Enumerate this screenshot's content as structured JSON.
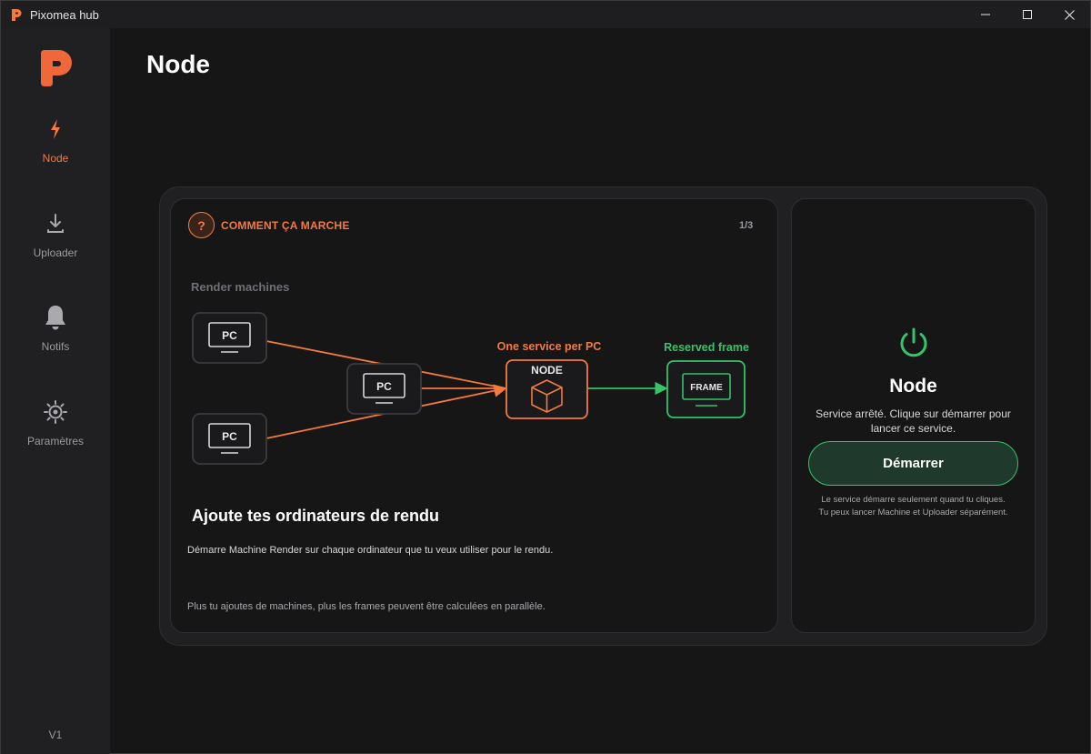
{
  "window": {
    "title": "Pixomea hub",
    "minimize": "—",
    "maximize": "☐",
    "close": "✕"
  },
  "sidebar": {
    "items": [
      {
        "label": "Node",
        "icon": "lightning-icon",
        "active": true
      },
      {
        "label": "Uploader",
        "icon": "download-icon",
        "active": false
      },
      {
        "label": "Notifs",
        "icon": "bell-icon",
        "active": false
      },
      {
        "label": "Paramètres",
        "icon": "gear-icon",
        "active": false
      }
    ],
    "version": "V1"
  },
  "page": {
    "title": "Node"
  },
  "howto": {
    "badge": "?",
    "title": "COMMENT ÇA MARCHE",
    "counter": "1/3",
    "diagram": {
      "group_label": "Render machines",
      "pc_label": "PC",
      "service_label": "One service per PC",
      "node_label": "NODE",
      "frame_title": "Reserved frame",
      "frame_label": "FRAME"
    },
    "heading": "Ajoute tes ordinateurs de rendu",
    "description": "Démarre Machine Render sur chaque ordinateur que tu veux utiliser pour le rendu.",
    "note": "Plus tu ajoutes de machines, plus les frames peuvent être calculées en parallèle."
  },
  "service": {
    "title": "Node",
    "status": "Service arrêté. Clique sur démarrer pour lancer ce service.",
    "start_label": "Démarrer",
    "hint_line1": "Le service démarre seulement quand tu cliques.",
    "hint_line2": "Tu peux lancer Machine et Uploader séparément."
  },
  "colors": {
    "accent": "#f47a3d",
    "success": "#34c46a",
    "background": "#161617",
    "sidebar": "#202022"
  }
}
